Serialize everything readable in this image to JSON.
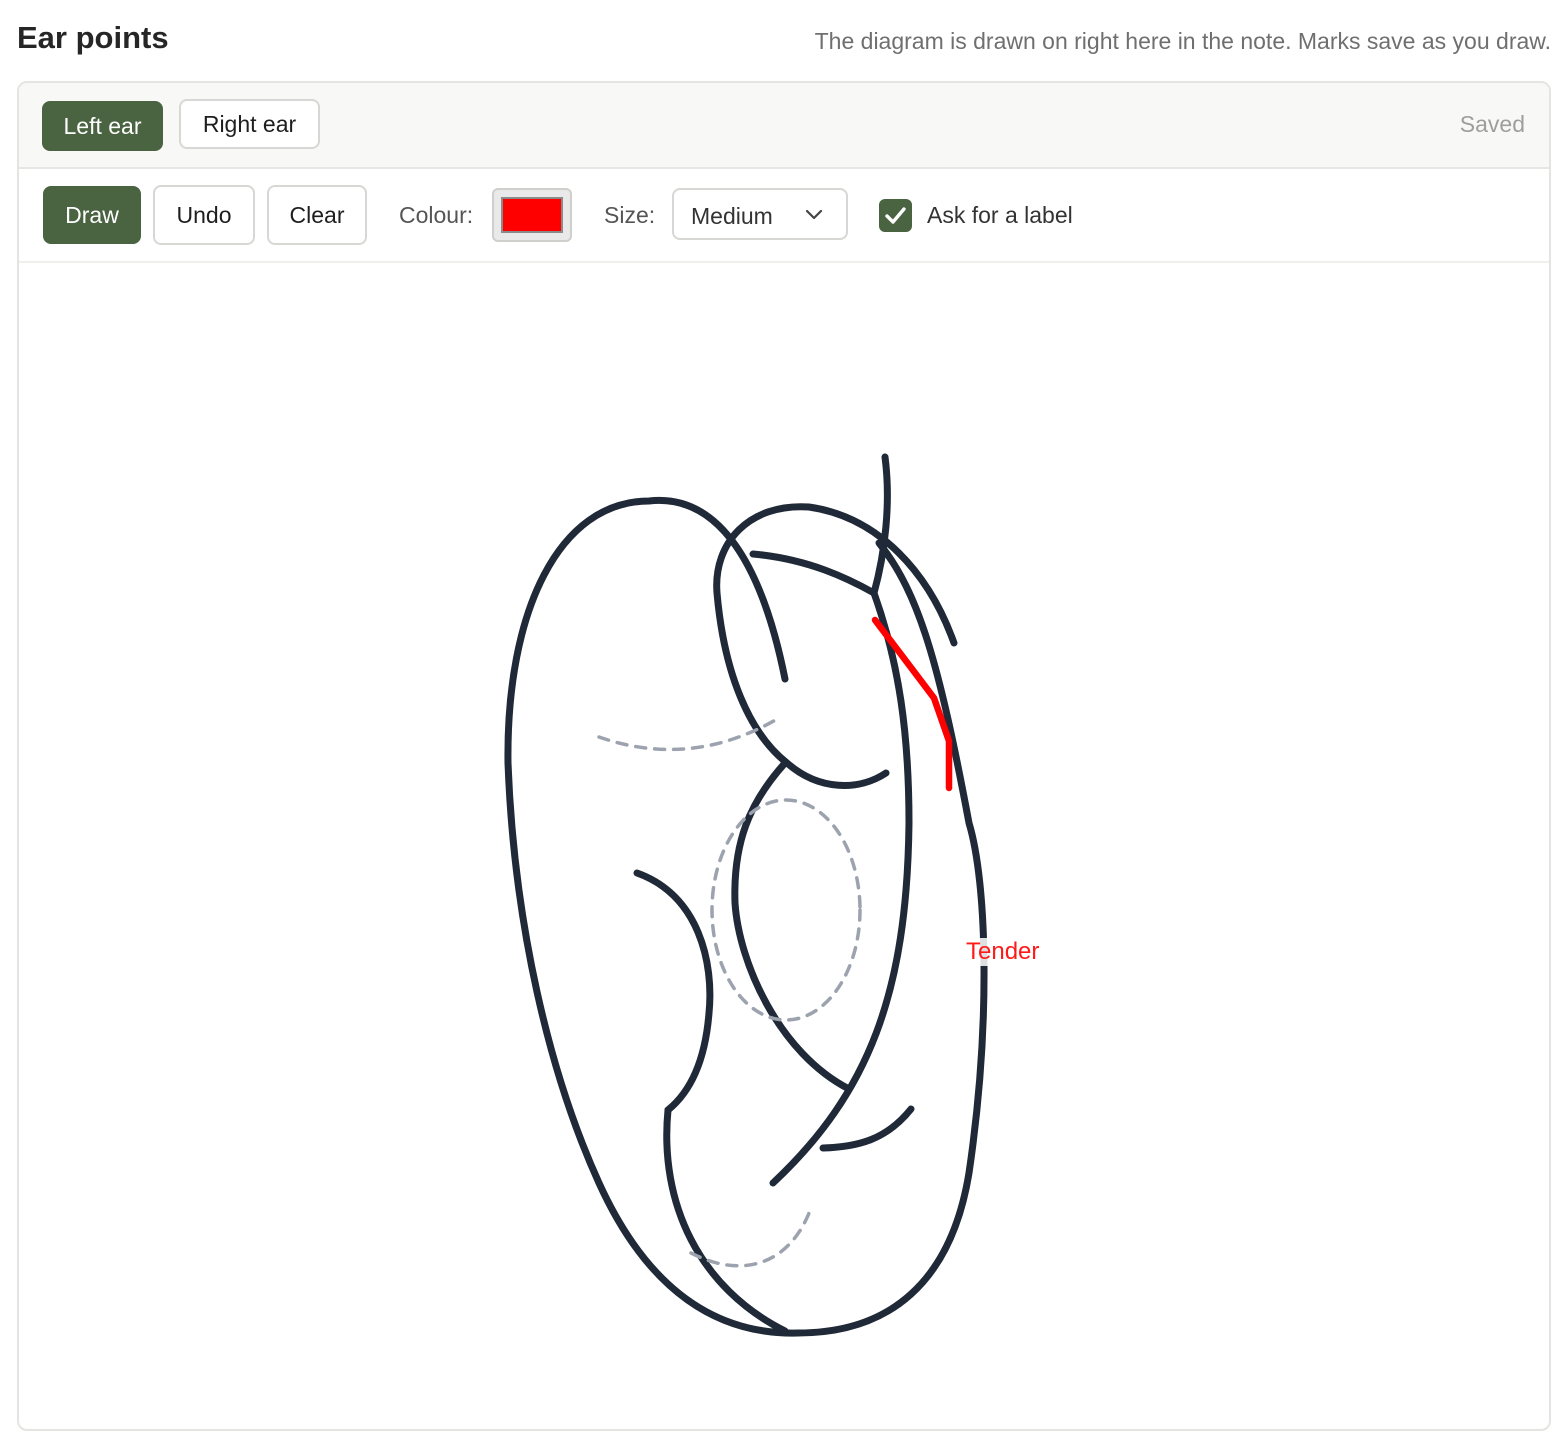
{
  "page": {
    "title": "Ear points",
    "hint": "The diagram is drawn on right here in the note. Marks save as you draw."
  },
  "tabs": {
    "left": "Left ear",
    "right": "Right ear",
    "selected": "Left ear"
  },
  "status": "Saved",
  "toolbar": {
    "draw": "Draw",
    "undo": "Undo",
    "clear": "Clear",
    "colour_label": "Colour:",
    "colour_value": "#ff0000",
    "size_label": "Size:",
    "size_value": "Medium",
    "ask_label": "Ask for a label",
    "ask_checked": true
  },
  "annotations": [
    {
      "label": "Tender",
      "color": "#ff0000"
    }
  ],
  "icons": {
    "chevron": "chevron-down-icon",
    "check": "checkmark-icon"
  },
  "colors": {
    "accent": "#4a6341",
    "ink": "#1f2937",
    "mark": "#ff0000",
    "guide": "#9ca3af"
  }
}
